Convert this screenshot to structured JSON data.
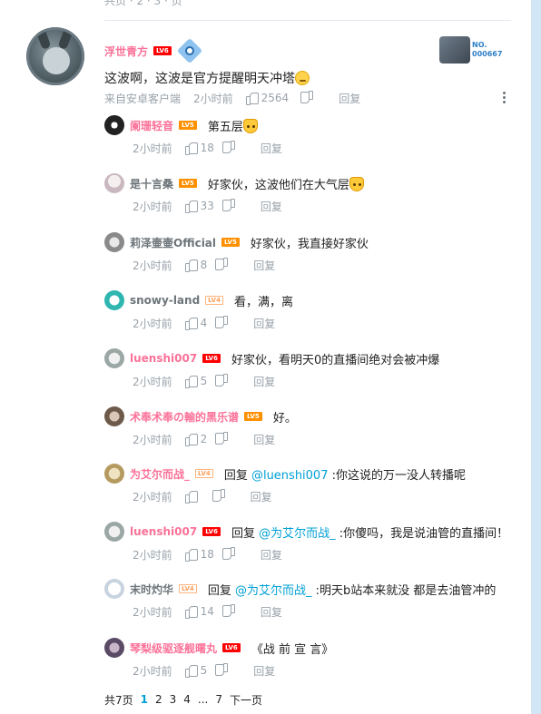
{
  "top_stub": "共页 · 2 · 3 · 页",
  "main_comment": {
    "username": "浮世青方",
    "level": "LV6",
    "fan_no": "NO.\n000667",
    "text": "这波啊，这波是官方提醒明天冲塔",
    "source": "来自安卓客户端",
    "time": "2小时前",
    "likes": "2564",
    "reply_label": "回复"
  },
  "replies": [
    {
      "username": "阑珊轻音",
      "level": "LV5",
      "text": "第五层",
      "time": "2小时前",
      "likes": "18",
      "reply_label": "回复",
      "emoji": "cat"
    },
    {
      "username": "是十言桑",
      "level": "LV5",
      "text": "好家伙，这波他们在大气层",
      "time": "2小时前",
      "likes": "33",
      "reply_label": "回复",
      "emoji": "cat"
    },
    {
      "username": "莉泽壷壷Official",
      "level": "LV5",
      "text": "好家伙，我直接好家伙",
      "time": "2小时前",
      "likes": "8",
      "reply_label": "回复"
    },
    {
      "username": "snowy-land",
      "level": "LV4",
      "text": "看，满，离",
      "time": "2小时前",
      "likes": "4",
      "reply_label": "回复"
    },
    {
      "username": "luenshi007",
      "level": "LV6",
      "text": "好家伙，看明天0的直播间绝对会被冲爆",
      "time": "2小时前",
      "likes": "5",
      "reply_label": "回复"
    },
    {
      "username": "术奉术奉の輸的黑乐谱",
      "level": "LV5",
      "text": "好。",
      "time": "2小时前",
      "likes": "2",
      "reply_label": "回复"
    },
    {
      "username": "为艾尔而战_",
      "level": "LV4",
      "text_prefix": "回复 ",
      "at": "@luenshi007",
      "text": " :你这说的万一没人转播呢",
      "time": "2小时前",
      "likes": "",
      "reply_label": "回复"
    },
    {
      "username": "luenshi007",
      "level": "LV6",
      "text_prefix": "回复 ",
      "at": "@为艾尔而战_",
      "text": " :你傻吗，我是说油管的直播间！",
      "time": "2小时前",
      "likes": "18",
      "reply_label": "回复"
    },
    {
      "username": "末时灼华",
      "level": "LV4",
      "text_prefix": "回复 ",
      "at": "@为艾尔而战_",
      "text": " :明天b站本来就没 都是去油管冲的",
      "time": "2小时前",
      "likes": "14",
      "reply_label": "回复"
    },
    {
      "username": "琴梨级驱逐舰曙丸",
      "level": "LV6",
      "text": "《战 前 宣 言》",
      "time": "2小时前",
      "likes": "5",
      "reply_label": "回复"
    }
  ],
  "pager": {
    "total": "共7页",
    "pages": [
      "1",
      "2",
      "3",
      "4",
      "...",
      "7"
    ],
    "next": "下一页"
  }
}
